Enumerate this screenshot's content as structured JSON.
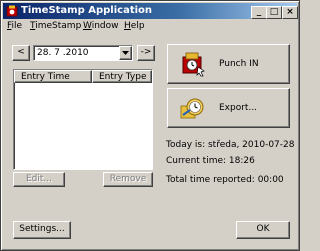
{
  "window": {
    "title": "TimeStamp Application"
  },
  "titlebar_buttons": {
    "minimize": "_",
    "maximize": "□",
    "close": "×"
  },
  "menu": [
    {
      "mnemonic": "F",
      "rest": "ile"
    },
    {
      "mnemonic": "T",
      "rest": "imeStamp"
    },
    {
      "mnemonic": "W",
      "rest": "indow"
    },
    {
      "mnemonic": "H",
      "rest": "elp"
    }
  ],
  "date_nav": {
    "prev": "<",
    "next": "->",
    "date_value": "28. 7 .2010"
  },
  "table": {
    "columns": [
      "Entry Time",
      "Entry Type"
    ],
    "rows": []
  },
  "buttons": {
    "edit": "Edit...",
    "remove": "Remove",
    "punch_in": "Punch IN",
    "export": "Export...",
    "settings": "Settings...",
    "ok": "OK"
  },
  "info": {
    "today": "Today is: středa, 2010-07-28",
    "current_time": "Current time: 18:26",
    "total_time": "Total time reported: 00:00"
  }
}
